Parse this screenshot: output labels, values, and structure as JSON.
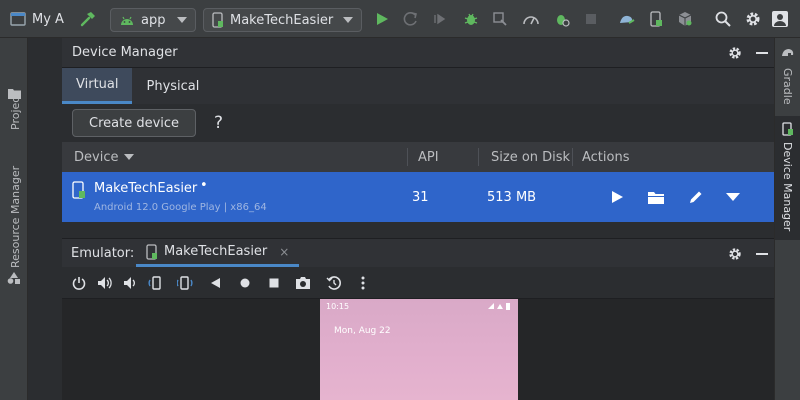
{
  "toolbar": {
    "project_label": "My A",
    "module_label": "app",
    "device_label": "MakeTechEasier"
  },
  "sidebar_left": {
    "project_label": "Project",
    "resource_manager_label": "Resource Manager"
  },
  "sidebar_right": {
    "gradle_label": "Gradle",
    "device_manager_label": "Device Manager"
  },
  "device_manager": {
    "title": "Device Manager",
    "tabs": [
      {
        "label": "Virtual",
        "active": true
      },
      {
        "label": "Physical",
        "active": false
      }
    ],
    "create_device_label": "Create device",
    "help_label": "?",
    "columns": {
      "device": "Device",
      "api": "API",
      "size": "Size on Disk",
      "actions": "Actions"
    },
    "rows": [
      {
        "name": "MakeTechEasier",
        "status_dot": "•",
        "subtitle": "Android 12.0 Google Play | x86_64",
        "api": "31",
        "size": "513 MB"
      }
    ]
  },
  "emulator": {
    "label": "Emulator:",
    "tab_label": "MakeTechEasier",
    "close_label": "×",
    "screen": {
      "time": "10:15",
      "date": "Mon, Aug 22"
    }
  },
  "colors": {
    "accent": "#4a88c7",
    "selection": "#2f65ca",
    "run_green": "#5fb85f"
  }
}
